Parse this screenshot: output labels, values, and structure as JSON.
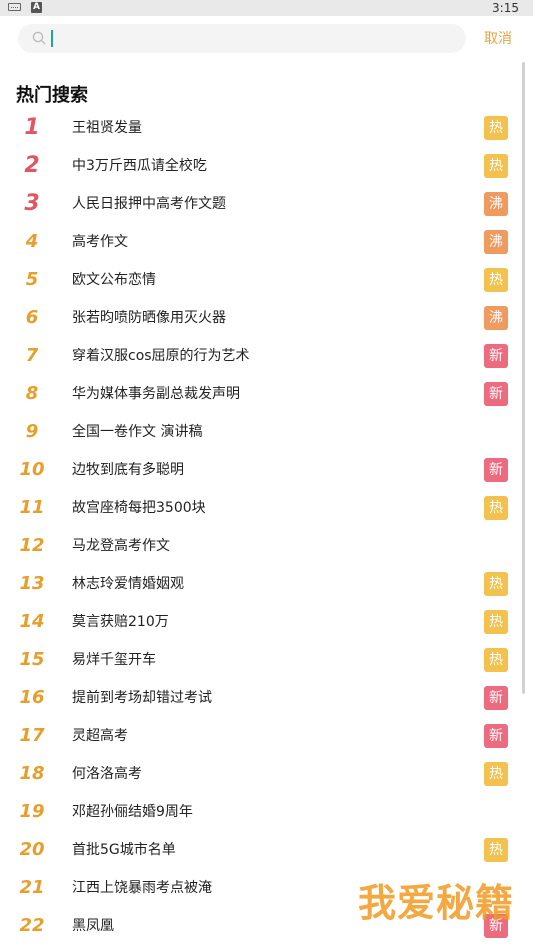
{
  "status_bar": {
    "input_icon": "A",
    "time": "3:15"
  },
  "search": {
    "placeholder": "",
    "value": "",
    "cancel_label": "取消"
  },
  "section_title": "热门搜索",
  "badge_colors": {
    "热": "#f2c14e",
    "沸": "#ef9a5f",
    "新": "#ec6b7e"
  },
  "hot_searches": [
    {
      "rank": "1",
      "title": "王祖贤发量",
      "badge": "热"
    },
    {
      "rank": "2",
      "title": "中3万斤西瓜请全校吃",
      "badge": "热"
    },
    {
      "rank": "3",
      "title": "人民日报押中高考作文题",
      "badge": "沸"
    },
    {
      "rank": "4",
      "title": "高考作文",
      "badge": "沸"
    },
    {
      "rank": "5",
      "title": "欧文公布恋情",
      "badge": "热"
    },
    {
      "rank": "6",
      "title": "张若昀喷防晒像用灭火器",
      "badge": "沸"
    },
    {
      "rank": "7",
      "title": "穿着汉服cos屈原的行为艺术",
      "badge": "新"
    },
    {
      "rank": "8",
      "title": "华为媒体事务副总裁发声明",
      "badge": "新"
    },
    {
      "rank": "9",
      "title": "全国一卷作文 演讲稿",
      "badge": ""
    },
    {
      "rank": "10",
      "title": "边牧到底有多聪明",
      "badge": "新"
    },
    {
      "rank": "11",
      "title": "故宫座椅每把3500块",
      "badge": "热"
    },
    {
      "rank": "12",
      "title": "马龙登高考作文",
      "badge": ""
    },
    {
      "rank": "13",
      "title": "林志玲爱情婚姻观",
      "badge": "热"
    },
    {
      "rank": "14",
      "title": "莫言获赔210万",
      "badge": "热"
    },
    {
      "rank": "15",
      "title": "易烊千玺开车",
      "badge": "热"
    },
    {
      "rank": "16",
      "title": "提前到考场却错过考试",
      "badge": "新"
    },
    {
      "rank": "17",
      "title": "灵超高考",
      "badge": "新"
    },
    {
      "rank": "18",
      "title": "何洛洛高考",
      "badge": "热"
    },
    {
      "rank": "19",
      "title": "邓超孙俪结婚9周年",
      "badge": ""
    },
    {
      "rank": "20",
      "title": "首批5G城市名单",
      "badge": "热"
    },
    {
      "rank": "21",
      "title": "江西上饶暴雨考点被淹",
      "badge": ""
    },
    {
      "rank": "22",
      "title": "黑凤凰",
      "badge": "新"
    }
  ],
  "watermark": "我爱秘籍"
}
